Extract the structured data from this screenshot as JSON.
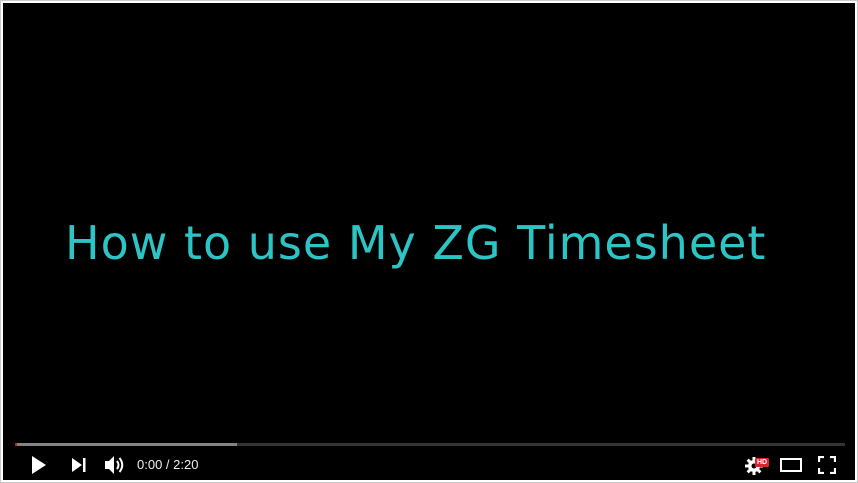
{
  "video": {
    "title_text": "How to use My ZG Timesheet"
  },
  "progress": {
    "played_fraction": 0.0,
    "loaded_fraction": 0.267
  },
  "controls": {
    "time_display": "0:00 / 2:20",
    "hd_badge": "HD",
    "icons": [
      "play-icon",
      "next-icon",
      "volume-icon",
      "settings-icon",
      "theater-mode-icon",
      "fullscreen-icon"
    ]
  },
  "colors": {
    "title_text": "#2cc4c4",
    "background": "#000000",
    "progress_played": "#cc181e",
    "hd_badge": "#d4272e"
  }
}
